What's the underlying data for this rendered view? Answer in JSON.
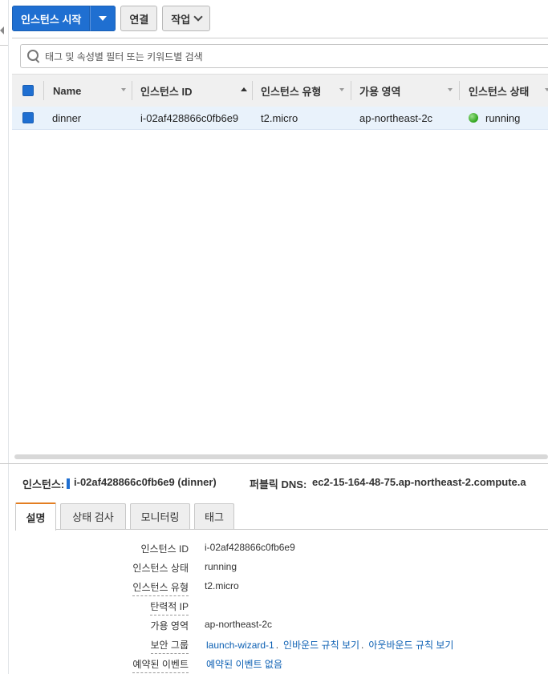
{
  "toolbar": {
    "launch_label": "인스턴스 시작",
    "connect_label": "연결",
    "actions_label": "작업"
  },
  "search": {
    "placeholder": "태그 및 속성별 필터 또는 키워드별 검색"
  },
  "table": {
    "columns": [
      {
        "label": "Name"
      },
      {
        "label": "인스턴스 ID"
      },
      {
        "label": "인스턴스 유형"
      },
      {
        "label": "가용 영역"
      },
      {
        "label": "인스턴스 상태"
      }
    ],
    "rows": [
      {
        "name": "dinner",
        "instance_id": "i-02af428866c0fb6e9",
        "instance_type": "t2.micro",
        "availability_zone": "ap-northeast-2c",
        "state": "running",
        "state_color": "#2ea31a"
      }
    ]
  },
  "detail_header": {
    "instance_label": "인스턴스:",
    "instance_value": "i-02af428866c0fb6e9 (dinner)",
    "dns_label": "퍼블릭 DNS:",
    "dns_value": "ec2-15-164-48-75.ap-northeast-2.compute.a"
  },
  "tabs": [
    {
      "label": "설명",
      "active": true
    },
    {
      "label": "상태 검사",
      "active": false
    },
    {
      "label": "모니터링",
      "active": false
    },
    {
      "label": "태그",
      "active": false
    }
  ],
  "details": {
    "instance_id": {
      "key": "인스턴스 ID",
      "value": "i-02af428866c0fb6e9"
    },
    "instance_state": {
      "key": "인스턴스 상태",
      "value": "running"
    },
    "instance_type": {
      "key": "인스턴스 유형",
      "value": "t2.micro"
    },
    "elastic_ip": {
      "key": "탄력적 IP",
      "value": ""
    },
    "availability_zone": {
      "key": "가용 영역",
      "value": "ap-northeast-2c"
    },
    "security_group": {
      "key": "보안 그룹",
      "group_link": "launch-wizard-1",
      "inbound_link": "인바운드 규칙 보기",
      "outbound_link": "아웃바운드 규칙 보기",
      "separator": "."
    },
    "scheduled_events": {
      "key": "예약된 이벤트",
      "value_link": "예약된 이벤트 없음"
    }
  },
  "colors": {
    "primary": "#1f6fd1",
    "active_tab_accent": "#e37e22",
    "link": "#0b5fb3",
    "selected_row": "#e9f2fb"
  }
}
